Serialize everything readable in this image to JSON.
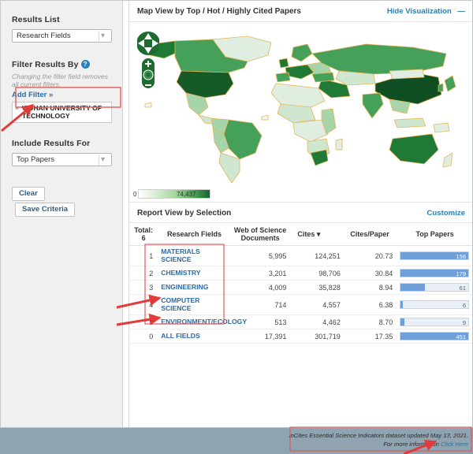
{
  "sidebar": {
    "results_list": {
      "label": "Results List",
      "value": "Research Fields"
    },
    "filter": {
      "label": "Filter Results By",
      "help_icon": "question-mark-icon",
      "hint": "Changing the filter field removes all current filters.",
      "add_filter": "Add Filter »",
      "chip_remove": "×",
      "chip_label": "WUHAN UNIVERSITY OF TECHNOLOGY"
    },
    "include": {
      "label": "Include Results For",
      "value": "Top Papers"
    },
    "buttons": {
      "clear": "Clear",
      "save": "Save Criteria"
    }
  },
  "map_panel": {
    "title": "Map View by Top / Hot / Highly Cited Papers",
    "hide_link": "Hide Visualization",
    "hide_dash": "—",
    "controls": {
      "pan_up": "pan-up-icon",
      "pan_down": "pan-down-icon",
      "pan_left": "pan-left-icon",
      "pan_right": "pan-right-icon",
      "zoom_in": "+",
      "zoom_out": "−",
      "reset": "globe-reset-icon"
    },
    "legend": {
      "min": "0",
      "max": "74,437"
    }
  },
  "report": {
    "title": "Report View by Selection",
    "customize": "Customize",
    "total_label": "Total:",
    "total_value": "6",
    "sort_indicator": "▾",
    "columns": [
      "Research Fields",
      "Web of Science Documents",
      "Cites",
      "Cites/Paper",
      "Top Papers"
    ],
    "rows": [
      {
        "rank": "1",
        "field": "MATERIALS SCIENCE",
        "documents": "5,995",
        "cites": "124,251",
        "cites_per_paper": "20.73",
        "top_papers": "156",
        "bar_pct": 100
      },
      {
        "rank": "2",
        "field": "CHEMISTRY",
        "documents": "3,201",
        "cites": "98,706",
        "cites_per_paper": "30.84",
        "top_papers": "179",
        "bar_pct": 100
      },
      {
        "rank": "3",
        "field": "ENGINEERING",
        "documents": "4,009",
        "cites": "35,828",
        "cites_per_paper": "8.94",
        "top_papers": "61",
        "bar_pct": 36
      },
      {
        "rank": "4",
        "field": "COMPUTER SCIENCE",
        "documents": "714",
        "cites": "4,557",
        "cites_per_paper": "6.38",
        "top_papers": "6",
        "bar_pct": 4
      },
      {
        "rank": "5",
        "field": "ENVIRONMENT/ECOLOGY",
        "documents": "513",
        "cites": "4,462",
        "cites_per_paper": "8.70",
        "top_papers": "9",
        "bar_pct": 6
      },
      {
        "rank": "0",
        "field": "ALL FIELDS",
        "documents": "17,391",
        "cites": "301,719",
        "cites_per_paper": "17.35",
        "top_papers": "451",
        "bar_pct": 100
      }
    ]
  },
  "footer": {
    "line1": "InCites Essential Science Indicators dataset updated May 13, 2021.",
    "line2_prefix": "For more information ",
    "line2_link": "Click Here"
  },
  "colors": {
    "accent_link": "#2b7fb5",
    "field_link": "#2a6aa8",
    "bar_fill": "#6f9fd8",
    "bar_track": "#e9eff7",
    "annotation_red": "#e05b5b",
    "map_control": "#1d6b2e",
    "page_bg": "#8fa3b0"
  }
}
